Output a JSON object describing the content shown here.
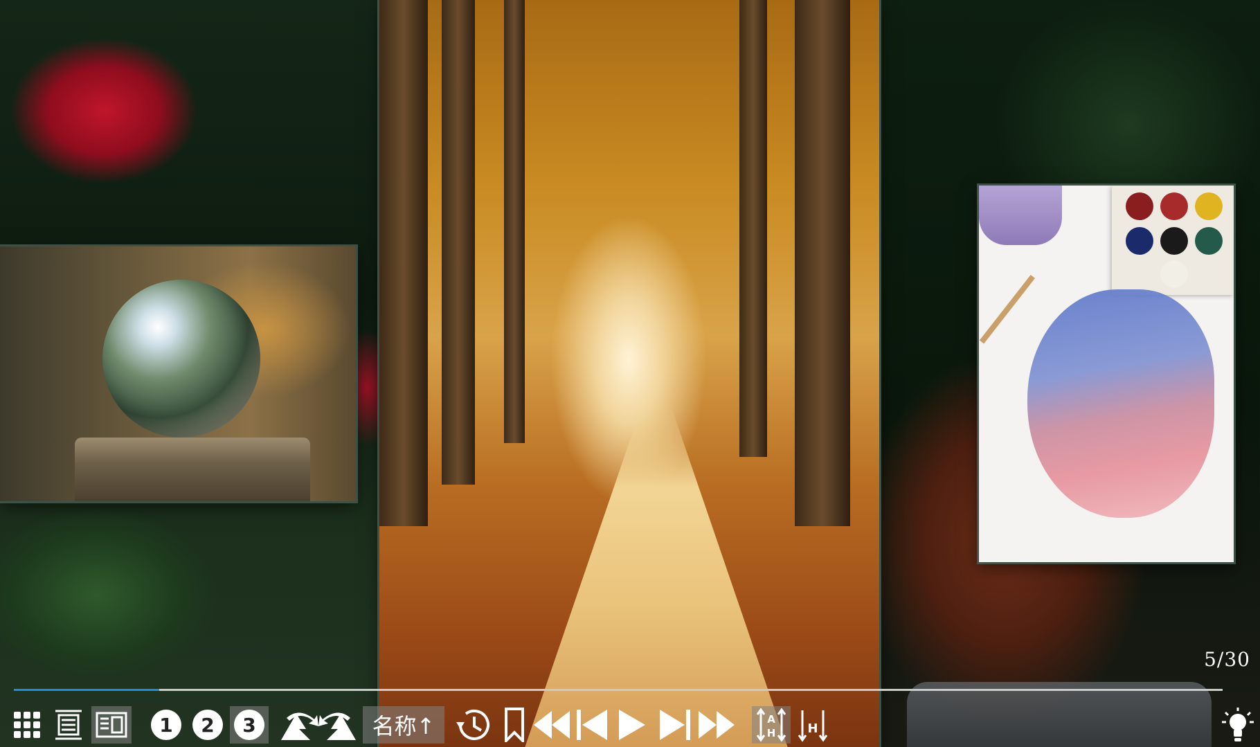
{
  "viewer": {
    "counter": "5/30",
    "progress_fraction": 0.12
  },
  "toolbar": {
    "layout_buttons": [
      {
        "icon": "grid-view-icon",
        "selected": false
      },
      {
        "icon": "list-view-icon",
        "selected": false
      },
      {
        "icon": "detail-view-icon",
        "selected": true
      }
    ],
    "pages": [
      {
        "label": "1",
        "selected": false
      },
      {
        "label": "2",
        "selected": false
      },
      {
        "label": "3",
        "selected": true
      }
    ],
    "rotate_icons": [
      "rotate-left-icon",
      "rotate-right-icon"
    ],
    "sort_label": "名称↑",
    "history_icon": "history-icon",
    "bookmark_icon": "bookmark-icon",
    "playback_icons": [
      "rewind-icon",
      "skip-back-icon",
      "play-icon",
      "skip-forward-icon",
      "fast-forward-icon"
    ],
    "fit_icons": [
      "fit-width-icon",
      "fit-height-icon"
    ],
    "light_icon": "lightbulb-icon"
  },
  "colors": {
    "progress": "#1a8fd8",
    "track": "#c9cbc9",
    "icon": "#ffffff"
  }
}
